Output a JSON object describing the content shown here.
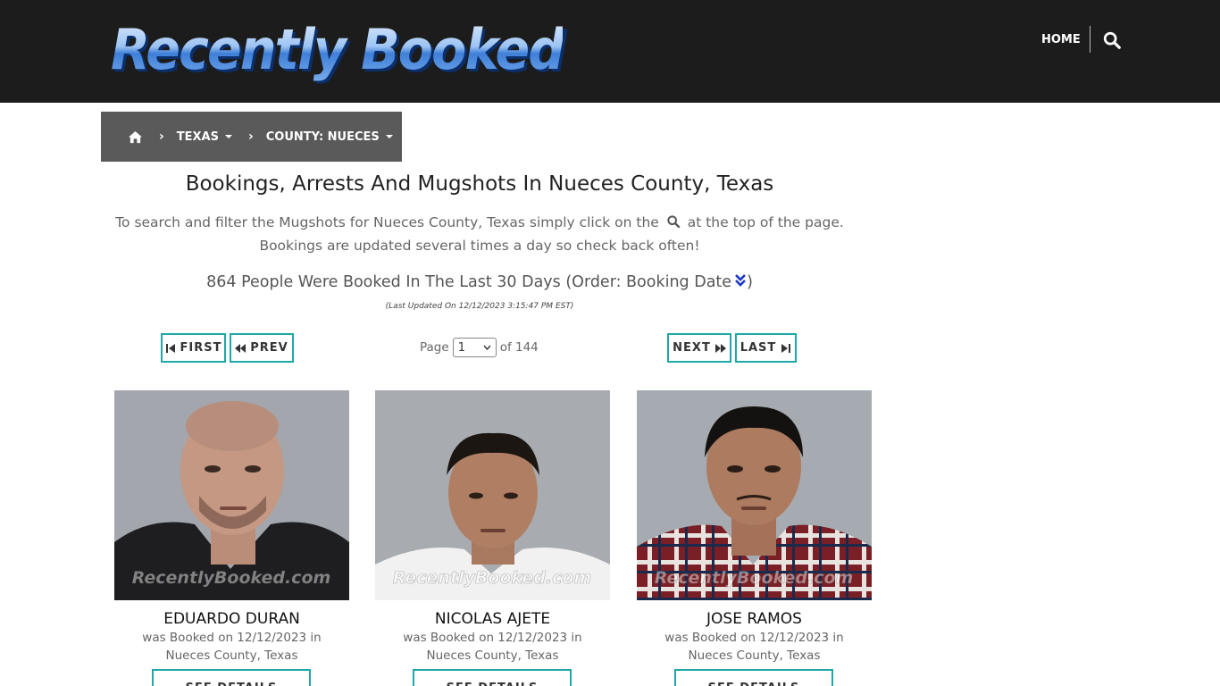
{
  "header": {
    "logo_text": "Recently Booked",
    "nav_home": "HOME"
  },
  "breadcrumb": {
    "state": "TEXAS",
    "county": "COUNTY: NUECES"
  },
  "page": {
    "title": "Bookings, Arrests And Mugshots In Nueces County, Texas",
    "intro_before": "To search and filter the Mugshots for Nueces County, Texas simply click on the",
    "intro_after": "at the top of the page. Bookings are updated several times a day so check back often!",
    "count_text": "864 People Were Booked In The Last 30 Days (Order: Booking Date",
    "count_close": ")",
    "updated": "(Last Updated On 12/12/2023 3:15:47 PM EST)"
  },
  "pager": {
    "first": "FIRST",
    "prev": "PREV",
    "next": "NEXT",
    "last": "LAST",
    "page_label": "Page",
    "current_page": "1",
    "of_label": "of 144"
  },
  "bookings": [
    {
      "name": "EDUARDO DURAN",
      "line1": "was Booked on 12/12/2023 in",
      "line2": "Nueces County, Texas",
      "watermark": "RecentlyBooked.com",
      "button": "SEE DETAILS"
    },
    {
      "name": "NICOLAS AJETE",
      "line1": "was Booked on 12/12/2023 in",
      "line2": "Nueces County, Texas",
      "watermark": "RecentlyBooked.com",
      "button": "SEE DETAILS"
    },
    {
      "name": "JOSE RAMOS",
      "line1": "was Booked on 12/12/2023 in",
      "line2": "Nueces County, Texas",
      "watermark": "RecentlyBooked.com",
      "button": "SEE DETAILS"
    }
  ],
  "colors": {
    "header_bg": "#1c1c1c",
    "breadcrumb_bg": "#5a5a5a",
    "button_border": "#1fa8a8",
    "sort_icon": "#1a35c9"
  },
  "icons": {
    "home": "home-icon",
    "search": "search-icon",
    "sort": "double-chevron-down-icon"
  }
}
